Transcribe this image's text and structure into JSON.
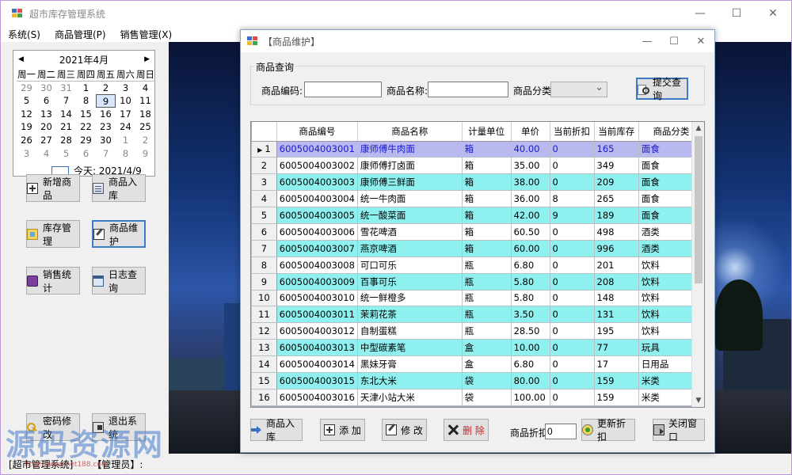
{
  "window": {
    "title": "超市库存管理系统",
    "controls": [
      "—",
      "☐",
      "✕"
    ]
  },
  "menu": [
    "系统(S)",
    "商品管理(P)",
    "销售管理(X)"
  ],
  "calendar": {
    "header": "2021年4月",
    "prev": "◀",
    "next": "▶",
    "weekdays": [
      "周一",
      "周二",
      "周三",
      "周四",
      "周五",
      "周六",
      "周日"
    ],
    "days": [
      [
        "29",
        "30",
        "31",
        "1",
        "2",
        "3",
        "4"
      ],
      [
        "5",
        "6",
        "7",
        "8",
        "9",
        "10",
        "11"
      ],
      [
        "12",
        "13",
        "14",
        "15",
        "16",
        "17",
        "18"
      ],
      [
        "19",
        "20",
        "21",
        "22",
        "23",
        "24",
        "25"
      ],
      [
        "26",
        "27",
        "28",
        "29",
        "30",
        "1",
        "2"
      ],
      [
        "3",
        "4",
        "5",
        "6",
        "7",
        "8",
        "9"
      ]
    ],
    "selected": "9",
    "today": "今天: 2021/4/9"
  },
  "nav_buttons": {
    "add_product": "新增商品",
    "stock_in": "商品入库",
    "inventory": "库存管理",
    "maintain": "商品维护",
    "sales_stats": "销售统计",
    "log_query": "日志查询",
    "change_password": "密码修改",
    "exit": "退出系统"
  },
  "status": {
    "app": "[超市管理系统]",
    "role": "【管理员】:"
  },
  "watermark": {
    "text": "源码资源网",
    "url": "http://www.net188.com"
  },
  "dialog": {
    "title": "【商品维护】",
    "controls": [
      "—",
      "☐",
      "✕"
    ],
    "query": {
      "group_title": "商品查询",
      "code_label": "商品编码:",
      "name_label": "商品名称:",
      "category_label": "商品分类:",
      "code_value": "",
      "name_value": "",
      "category_value": "",
      "submit": "提交查询"
    },
    "table": {
      "columns": [
        "商品编号",
        "商品名称",
        "计量单位",
        "单价",
        "当前折扣",
        "当前库存",
        "商品分类"
      ],
      "rows": [
        [
          "1",
          "6005004003001",
          "康师傅牛肉面",
          "箱",
          "40.00",
          "0",
          "165",
          "面食"
        ],
        [
          "2",
          "6005004003002",
          "康师傅打卤面",
          "箱",
          "35.00",
          "0",
          "349",
          "面食"
        ],
        [
          "3",
          "6005004003003",
          "康师傅三鲜面",
          "箱",
          "38.00",
          "0",
          "209",
          "面食"
        ],
        [
          "4",
          "6005004003004",
          "统一牛肉面",
          "箱",
          "36.00",
          "8",
          "265",
          "面食"
        ],
        [
          "5",
          "6005004003005",
          "统一酸菜面",
          "箱",
          "42.00",
          "9",
          "189",
          "面食"
        ],
        [
          "6",
          "6005004003006",
          "雪花啤酒",
          "箱",
          "60.50",
          "0",
          "498",
          "酒类"
        ],
        [
          "7",
          "6005004003007",
          "燕京啤酒",
          "箱",
          "60.00",
          "0",
          "996",
          "酒类"
        ],
        [
          "8",
          "6005004003008",
          "可口可乐",
          "瓶",
          "6.80",
          "0",
          "201",
          "饮料"
        ],
        [
          "9",
          "6005004003009",
          "百事可乐",
          "瓶",
          "5.80",
          "0",
          "208",
          "饮料"
        ],
        [
          "10",
          "6005004003010",
          "统一鲜橙多",
          "瓶",
          "5.80",
          "0",
          "148",
          "饮料"
        ],
        [
          "11",
          "6005004003011",
          "茉莉花茶",
          "瓶",
          "3.50",
          "0",
          "131",
          "饮料"
        ],
        [
          "12",
          "6005004003012",
          "自制蛋糕",
          "瓶",
          "28.50",
          "0",
          "195",
          "饮料"
        ],
        [
          "13",
          "6005004003013",
          "中型碳素笔",
          "盒",
          "10.00",
          "0",
          "77",
          "玩具"
        ],
        [
          "14",
          "6005004003014",
          "黑妹牙膏",
          "盒",
          "6.80",
          "0",
          "17",
          "日用品"
        ],
        [
          "15",
          "6005004003015",
          "东北大米",
          "袋",
          "80.00",
          "0",
          "159",
          "米类"
        ],
        [
          "16",
          "6005004003016",
          "天津小站大米",
          "袋",
          "100.00",
          "0",
          "159",
          "米类"
        ]
      ],
      "selected_row": "1",
      "row_indicator": "▶"
    },
    "actions": {
      "stock_in": "商品入库",
      "add": "添 加",
      "edit": "修 改",
      "delete": "删 除",
      "discount_label": "商品折扣:",
      "discount_value": "0",
      "update_discount": "更新折扣",
      "close": "关闭窗口"
    }
  },
  "colors": {
    "row_odd": "#8ff0f0",
    "row_even": "#ffffff",
    "row_selected": "#b9b9f0",
    "focus_border": "#3d7bc8"
  }
}
